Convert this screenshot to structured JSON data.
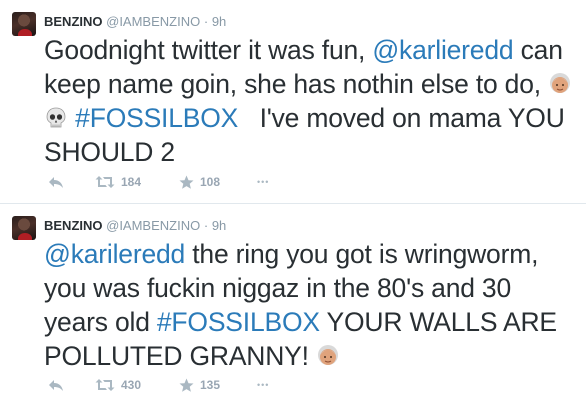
{
  "tweets": [
    {
      "fullname": "BENZINO",
      "username": "@IAMBENZINO",
      "separator": "·",
      "time": "9h",
      "text_parts": {
        "p1": "Goodnight twitter it was fun, ",
        "mention": "@karlieredd",
        "p2": " can keep name goin, she has nothin else to do, ",
        "hashtag": "#FOSSILBOX",
        "p3": "   I've moved on mama YOU SHOULD 2"
      },
      "emojis": [
        "older-woman-emoji",
        "skull-emoji"
      ],
      "retweets": "184",
      "favorites": "108",
      "more": "•••"
    },
    {
      "fullname": "BENZINO",
      "username": "@IAMBENZINO",
      "separator": "·",
      "time": "9h",
      "text_parts": {
        "mention": "@karileredd",
        "p1": " the ring you got is wringworm, you was fuckin niggaz in the 80's and 30 years old ",
        "hashtag": "#FOSSILBOX",
        "p2": " YOUR WALLS ARE POLLUTED GRANNY! "
      },
      "emojis": [
        "older-woman-emoji"
      ],
      "retweets": "430",
      "favorites": "135",
      "more": "•••"
    }
  ],
  "colors": {
    "text": "#292f33",
    "link": "#2b7bb9",
    "muted": "#8899a6",
    "action_icon": "#aab8c2",
    "divider": "#e1e8ed"
  }
}
